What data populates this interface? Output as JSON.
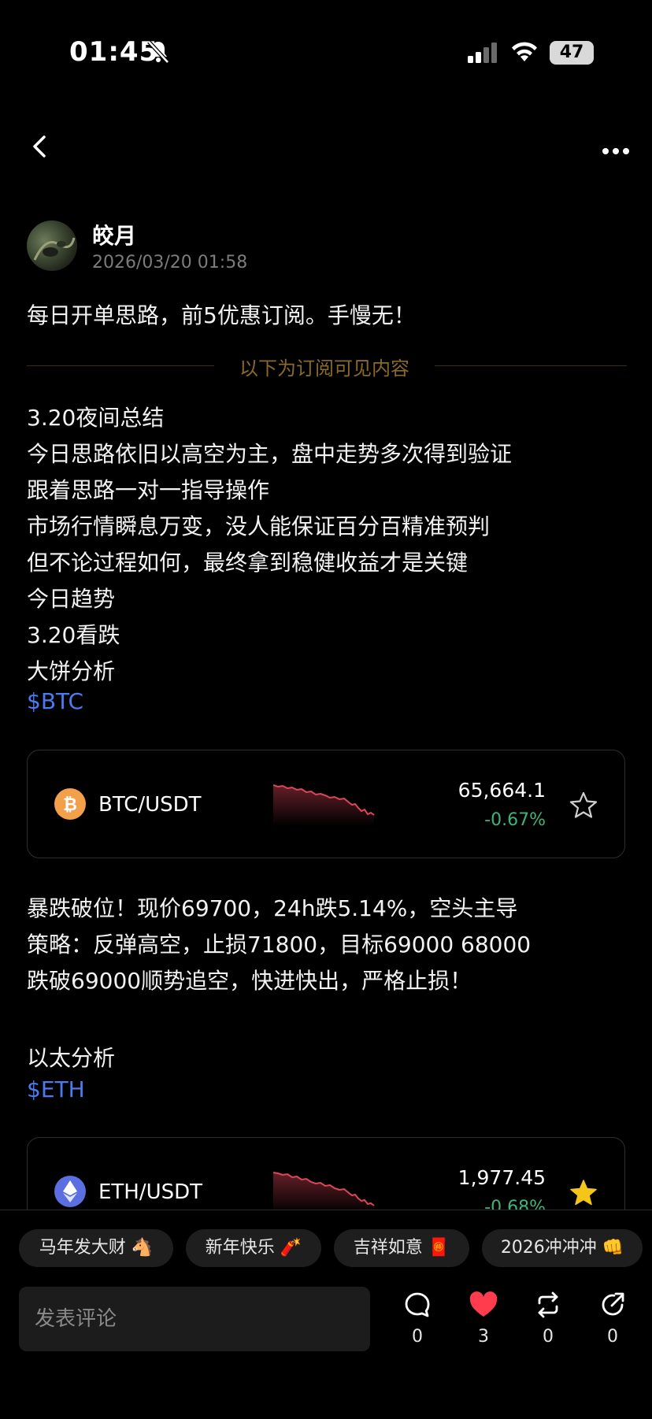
{
  "status_bar": {
    "time": "01:45",
    "battery": "47"
  },
  "author": {
    "name": "皎月",
    "timestamp": "2026/03/20 01:58"
  },
  "post": {
    "headline": "每日开单思路，前5优惠订阅。手慢无！",
    "divider_label": "以下为订阅可见内容",
    "summary_lines": [
      "3.20夜间总结",
      "今日思路依旧以高空为主，盘中走势多次得到验证",
      "跟着思路一对一指导操作",
      "市场行情瞬息万变，没人能保证百分百精准预判",
      "但不论过程如何，最终拿到稳健收益才是关键",
      "今日趋势",
      "3.20看跌",
      "大饼分析"
    ],
    "btc_tag": "$BTC",
    "btc_analysis_lines": [
      "暴跌破位！现价69700，24h跌5.14%，空头主导",
      "策略：反弹高空，止损71800，目标69000 68000",
      "跌破69000顺势追空，快进快出，严格止损！"
    ],
    "eth_title": "以太分析",
    "eth_tag": "$ETH"
  },
  "cards": {
    "btc": {
      "pair": "BTC/USDT",
      "price": "65,664.1",
      "change": "-0.67%",
      "favorited": false
    },
    "eth": {
      "pair": "ETH/USDT",
      "price": "1,977.45",
      "change": "-0.68%",
      "favorited": true
    }
  },
  "quick_replies": [
    "马年发大财 🐴",
    "新年快乐 🧨",
    "吉祥如意 🧧",
    "2026冲冲冲 👊"
  ],
  "comment": {
    "placeholder": "发表评论"
  },
  "actions": {
    "comments": "0",
    "likes": "3",
    "reposts": "0",
    "shares": "0"
  },
  "colors": {
    "accent_blue": "#4b7bf0",
    "positive_green": "#3fb37a",
    "negative_red": "#e0465a",
    "like_red": "#ff3b4e",
    "star_gold": "#f5c518",
    "divider_gold": "#8a6a2a"
  }
}
